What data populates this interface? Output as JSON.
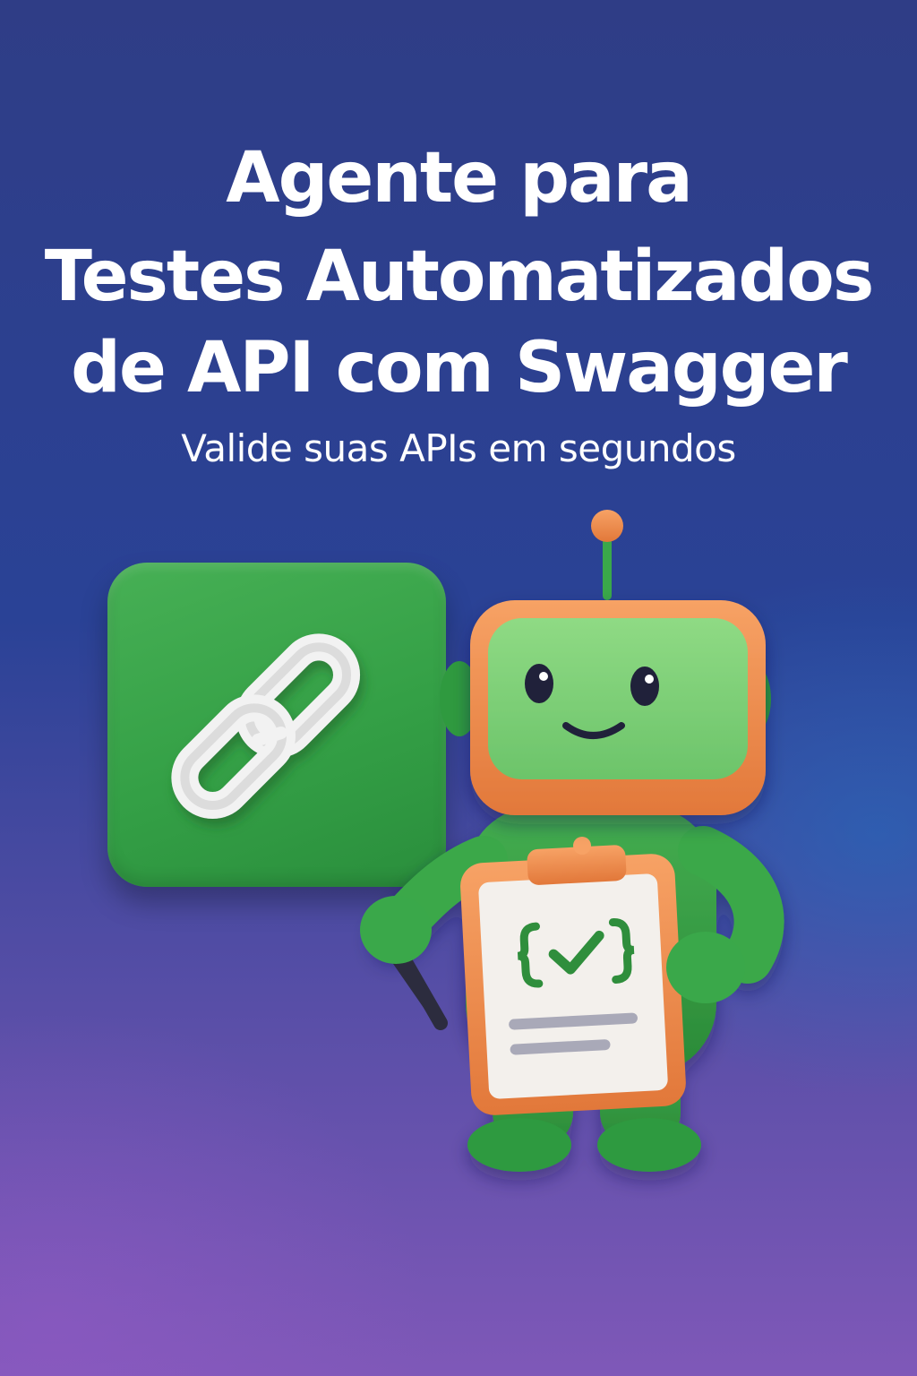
{
  "title": {
    "line1": "Agente para",
    "line2": "Testes Automatizados",
    "line3": "de API com Swagger"
  },
  "subtitle": "Valide suas APIs em segundos",
  "illustration": {
    "link_icon": "chain-link-icon",
    "robot": "robot-mascot",
    "clipboard_icon": "code-check-icon"
  },
  "colors": {
    "background_top": "#2f3d86",
    "background_bottom": "#7f58b8",
    "tile_green": "#3aa84a",
    "robot_orange": "#f08a4b",
    "robot_green": "#37a046",
    "screen_green": "#7fcf77"
  }
}
